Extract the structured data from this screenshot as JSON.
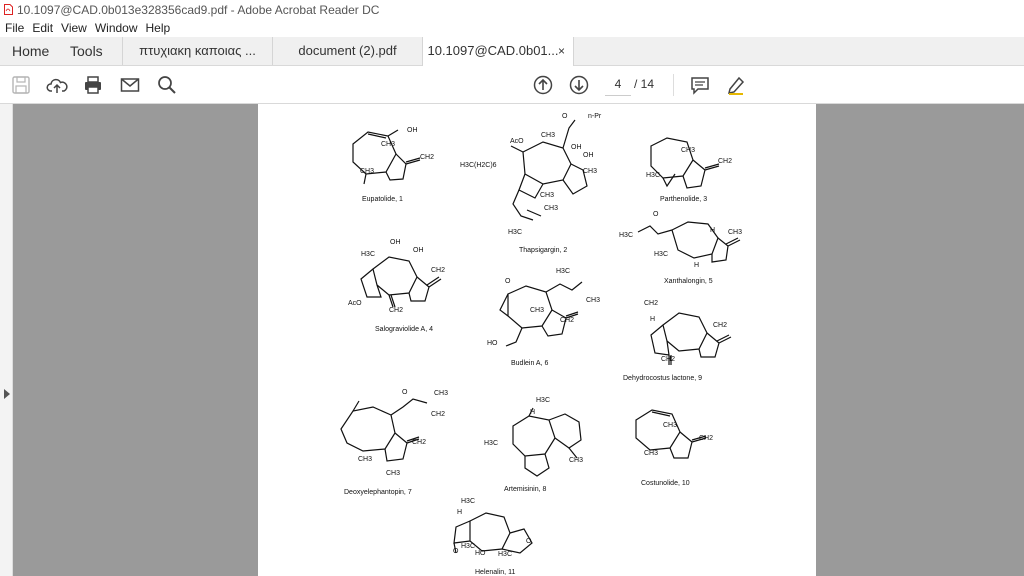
{
  "titlebar": {
    "title": "10.1097@CAD.0b013e328356cad9.pdf - Adobe Acrobat Reader DC"
  },
  "menu": [
    "File",
    "Edit",
    "View",
    "Window",
    "Help"
  ],
  "nav": {
    "home": "Home",
    "tools": "Tools"
  },
  "tabs": [
    {
      "label": "πτυχιακη καποιας ..."
    },
    {
      "label": "document (2).pdf"
    },
    {
      "label": "10.1097@CAD.0b01...",
      "close": "×"
    }
  ],
  "toolbar": {
    "page_current": "4",
    "page_total": "/  14"
  },
  "compounds": [
    {
      "label": "Eupatolide, 1"
    },
    {
      "label": "Thapsigargin, 2"
    },
    {
      "label": "Parthenolide, 3"
    },
    {
      "label": "Salograviolide A, 4"
    },
    {
      "label": "Xanthalongin, 5"
    },
    {
      "label": "Budlein A, 6"
    },
    {
      "label": "Dehydrocostus lactone, 9"
    },
    {
      "label": "Deoxyelephantopin, 7"
    },
    {
      "label": "Artemisinin, 8"
    },
    {
      "label": "Costunolide, 10"
    },
    {
      "label": "Helenalin, 11"
    }
  ],
  "atoms": {
    "oh": "OH",
    "ch3": "CH3",
    "ch2": "CH2",
    "h3c": "H3C",
    "o": "O",
    "h": "H",
    "aco": "AcO",
    "npr": "n-Pr",
    "ho": "HO",
    "ch36": "H3C(H2C)6"
  }
}
